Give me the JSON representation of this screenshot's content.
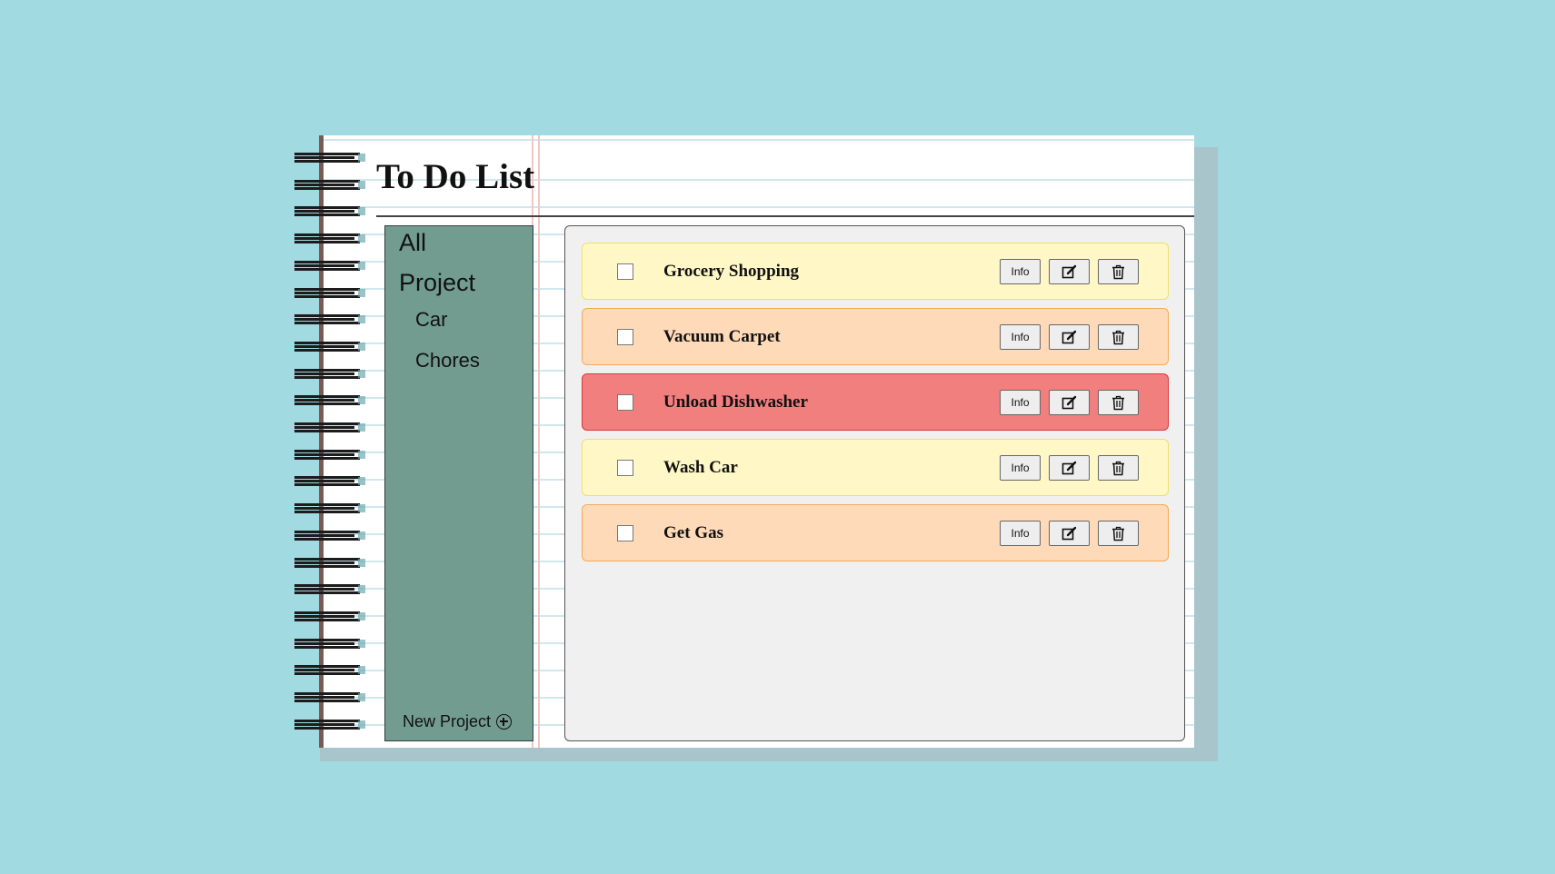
{
  "app": {
    "title": "To Do List"
  },
  "sidebar": {
    "all_label": "All",
    "project_heading": "Project",
    "projects": [
      {
        "label": "Car"
      },
      {
        "label": "Chores"
      }
    ],
    "new_project_label": "New Project",
    "new_project_icon": "plus-circle-icon"
  },
  "tasks": [
    {
      "name": "Grocery Shopping",
      "priority": "low",
      "checked": false,
      "info_label": "Info",
      "edit_icon": "edit-icon",
      "delete_icon": "trash-icon"
    },
    {
      "name": "Vacuum Carpet",
      "priority": "medium",
      "checked": false,
      "info_label": "Info",
      "edit_icon": "edit-icon",
      "delete_icon": "trash-icon"
    },
    {
      "name": "Unload Dishwasher",
      "priority": "high",
      "checked": false,
      "info_label": "Info",
      "edit_icon": "edit-icon",
      "delete_icon": "trash-icon"
    },
    {
      "name": "Wash Car",
      "priority": "low",
      "checked": false,
      "info_label": "Info",
      "edit_icon": "edit-icon",
      "delete_icon": "trash-icon"
    },
    {
      "name": "Get Gas",
      "priority": "medium",
      "checked": false,
      "info_label": "Info",
      "edit_icon": "edit-icon",
      "delete_icon": "trash-icon"
    }
  ],
  "colors": {
    "page_background": "#a2dae2",
    "sidebar_background": "#739c91",
    "priority_low": "#fff8c6",
    "priority_medium": "#ffdab8",
    "priority_high": "#f07f7e"
  }
}
